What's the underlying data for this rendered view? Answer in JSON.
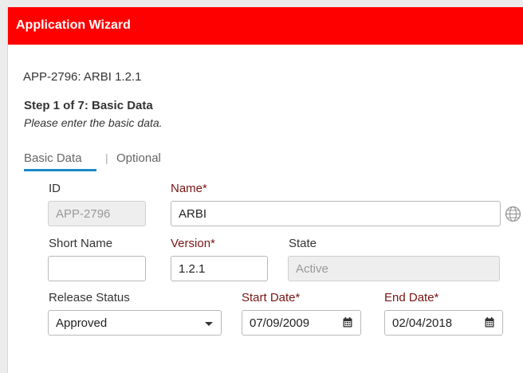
{
  "window": {
    "title": "Application Wizard"
  },
  "header": {
    "app_id_line": "APP-2796: ARBI 1.2.1",
    "step_title": "Step 1 of 7: Basic Data",
    "step_subtitle": "Please enter the basic data."
  },
  "tabs": [
    {
      "label": "Basic Data",
      "active": true
    },
    {
      "label": "Optional",
      "active": false
    }
  ],
  "tab_separator": "|",
  "form": {
    "id": {
      "label": "ID",
      "value": "APP-2796",
      "disabled": true
    },
    "name": {
      "label": "Name*",
      "value": "ARBI"
    },
    "short_name": {
      "label": "Short Name",
      "value": ""
    },
    "version": {
      "label": "Version*",
      "value": "1.2.1"
    },
    "state": {
      "label": "State",
      "value": "Active",
      "disabled": true
    },
    "release_status": {
      "label": "Release Status",
      "value": "Approved"
    },
    "start_date": {
      "label": "Start Date*",
      "value": "07/09/2009"
    },
    "end_date": {
      "label": "End Date*",
      "value": "02/04/2018"
    }
  },
  "icons": {
    "globe": "globe-icon",
    "calendar": "calendar-icon",
    "dropdown": "chevron-down-icon"
  },
  "colors": {
    "title_bar": "#ff0000",
    "required_label": "#7a1414",
    "active_tab_underline": "#1a8ac6"
  }
}
